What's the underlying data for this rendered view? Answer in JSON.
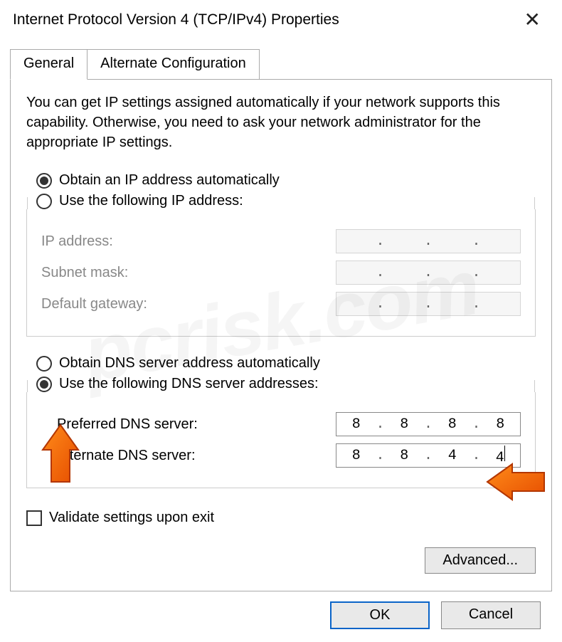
{
  "title": "Internet Protocol Version 4 (TCP/IPv4) Properties",
  "tabs": {
    "general": "General",
    "alternate": "Alternate Configuration"
  },
  "description": "You can get IP settings assigned automatically if your network supports this capability. Otherwise, you need to ask your network administrator for the appropriate IP settings.",
  "ip_section": {
    "auto_label": "Obtain an IP address automatically",
    "manual_label": "Use the following IP address:",
    "selected": "auto",
    "fields": {
      "ip_label": "IP address:",
      "subnet_label": "Subnet mask:",
      "gateway_label": "Default gateway:",
      "ip_value": [
        "",
        "",
        "",
        ""
      ],
      "subnet_value": [
        "",
        "",
        "",
        ""
      ],
      "gateway_value": [
        "",
        "",
        "",
        ""
      ]
    }
  },
  "dns_section": {
    "auto_label": "Obtain DNS server address automatically",
    "manual_label": "Use the following DNS server addresses:",
    "selected": "manual",
    "fields": {
      "preferred_label": "Preferred DNS server:",
      "alternate_label": "Alternate DNS server:",
      "preferred_value": [
        "8",
        "8",
        "8",
        "8"
      ],
      "alternate_value": [
        "8",
        "8",
        "4",
        "4"
      ]
    }
  },
  "validate_label": "Validate settings upon exit",
  "validate_checked": false,
  "advanced_label": "Advanced...",
  "buttons": {
    "ok": "OK",
    "cancel": "Cancel"
  },
  "watermark": "pcrisk.com"
}
